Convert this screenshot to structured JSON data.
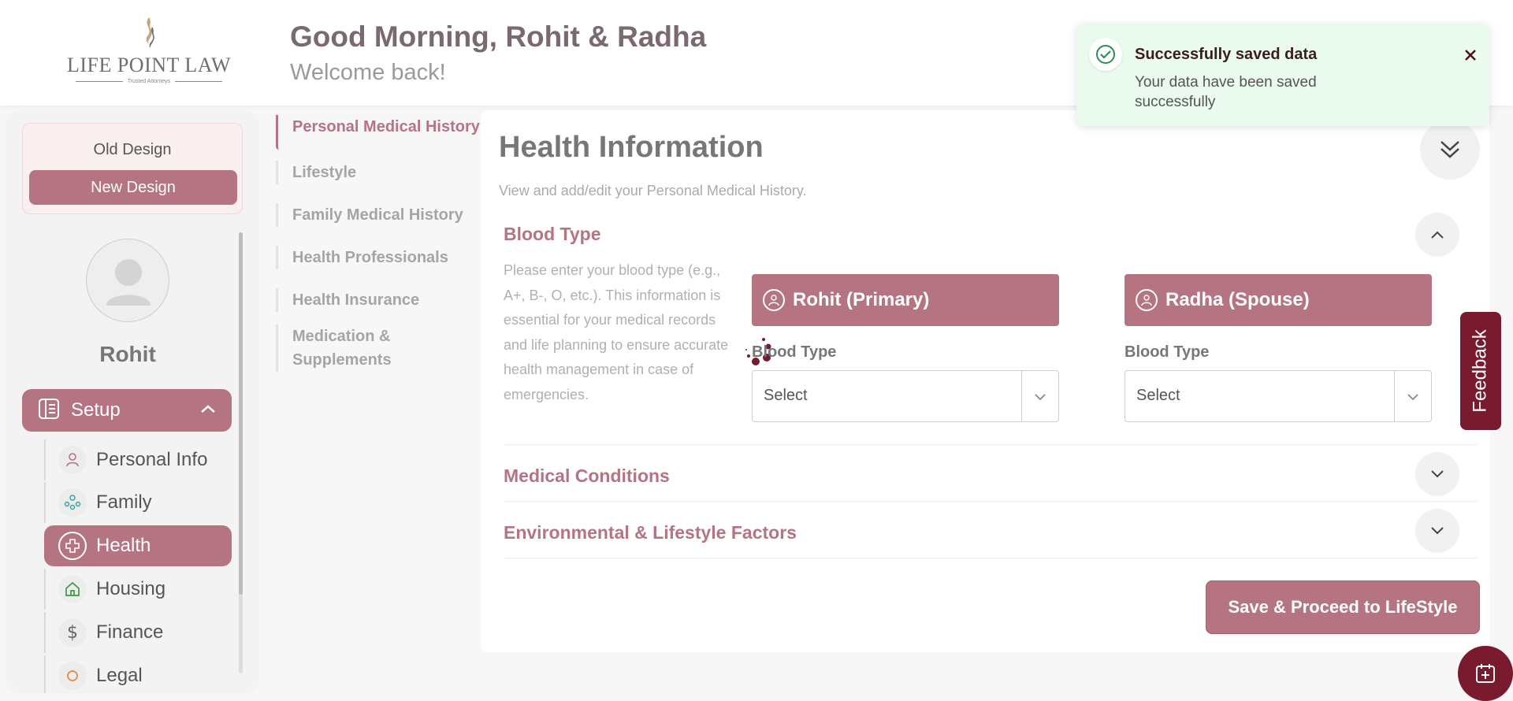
{
  "brand": {
    "name": "LIFE POINT LAW",
    "tagline": "Trusted Attorneys"
  },
  "header": {
    "greeting": "Good Morning, Rohit & Radha",
    "welcome": "Welcome back!"
  },
  "design_switch": {
    "old_label": "Old Design",
    "new_label": "New Design"
  },
  "user": {
    "name": "Rohit"
  },
  "sidebar": {
    "setup_label": "Setup",
    "items": [
      {
        "label": "Personal Info",
        "icon": "person-icon"
      },
      {
        "label": "Family",
        "icon": "family-icon"
      },
      {
        "label": "Health",
        "icon": "health-cross-icon",
        "active": true
      },
      {
        "label": "Housing",
        "icon": "house-icon"
      },
      {
        "label": "Finance",
        "icon": "dollar-icon"
      },
      {
        "label": "Legal",
        "icon": "legal-icon"
      }
    ]
  },
  "section_nav": [
    {
      "label": "Personal Medical History",
      "active": true
    },
    {
      "label": "Lifestyle"
    },
    {
      "label": "Family Medical History"
    },
    {
      "label": "Health Professionals"
    },
    {
      "label": "Health Insurance"
    },
    {
      "label": "Medication &"
    },
    {
      "label": "Supplements"
    }
  ],
  "main": {
    "title": "Health Information",
    "subtitle": "View and add/edit your Personal Medical History.",
    "blood_type": {
      "title": "Blood Type",
      "description": "Please enter your blood type (e.g., A+, B-, O, etc.). This information is essential for your medical records and life planning to ensure accurate health management in case of emergencies.",
      "persons": [
        {
          "name": "Rohit (Primary)",
          "field_label": "Blood Type",
          "value": "Select"
        },
        {
          "name": "Radha (Spouse)",
          "field_label": "Blood Type",
          "value": "Select"
        }
      ]
    },
    "medical_conditions": {
      "title": "Medical Conditions"
    },
    "environmental": {
      "title": "Environmental & Lifestyle Factors"
    },
    "save_button": "Save & Proceed to LifeStyle"
  },
  "feedback_label": "Feedback",
  "toast": {
    "title": "Successfully saved data",
    "message": "Your data have been saved successfully"
  },
  "colors": {
    "accent": "#b47482",
    "dark_accent": "#7a1a2e",
    "toast_bg": "#ebfaef",
    "success": "#2e8b57"
  }
}
